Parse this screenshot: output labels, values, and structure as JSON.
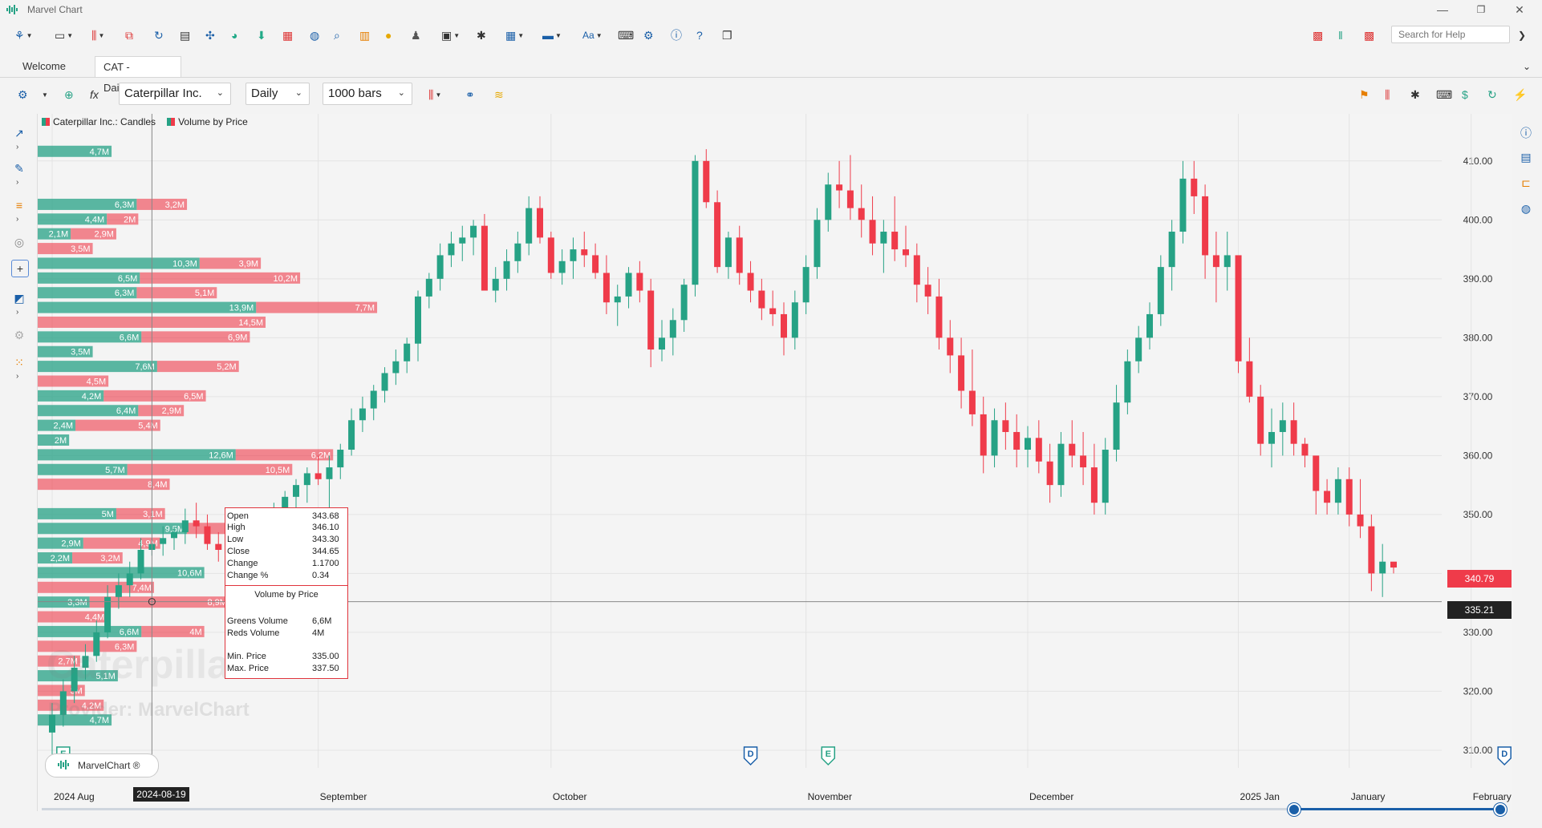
{
  "app": {
    "title": "Marvel Chart"
  },
  "window": {
    "minimize": "—",
    "restore": "❐",
    "close": "✕"
  },
  "help": {
    "placeholder": "Search for Help"
  },
  "tabs": [
    {
      "label": "Welcome"
    },
    {
      "label": "CAT - Daily",
      "close": "✕"
    }
  ],
  "toolbar2": {
    "symbol": "Caterpillar Inc.",
    "interval": "Daily",
    "bars": "1000 bars"
  },
  "legend": {
    "candles": "Caterpillar Inc.: Candles",
    "volume": "Volume by Price"
  },
  "colors": {
    "up": "#26a285",
    "down": "#ef3b4a",
    "accent": "#1a5fa8"
  },
  "tooltip": {
    "rows": [
      {
        "label": "Open",
        "value": "343.68"
      },
      {
        "label": "High",
        "value": "346.10"
      },
      {
        "label": "Low",
        "value": "343.30"
      },
      {
        "label": "Close",
        "value": "344.65"
      },
      {
        "label": "Change",
        "value": "1.1700"
      },
      {
        "label": "Change %",
        "value": "0.34"
      }
    ],
    "vbp_title": "Volume by Price",
    "vbp_rows": [
      {
        "label": "Greens Volume",
        "value": "6,6M"
      },
      {
        "label": "Reds Volume",
        "value": "4M"
      },
      {
        "label": "Min. Price",
        "value": "335.00"
      },
      {
        "label": "Max. Price",
        "value": "337.50"
      }
    ]
  },
  "watermark": {
    "name": "Caterpillar Inc.",
    "provider": "Provider: MarvelChart"
  },
  "brand": "MarvelChart ®",
  "price_tags": {
    "last": "340.79",
    "cursor": "335.21"
  },
  "date_tag": "2024-08-19",
  "chart_data": {
    "type": "candlestick",
    "y_ticks": [
      "410.00",
      "400.00",
      "390.00",
      "380.00",
      "370.00",
      "360.00",
      "350.00",
      "340.00",
      "330.00",
      "320.00",
      "310.00"
    ],
    "y_tick_values": [
      410,
      400,
      390,
      380,
      370,
      360,
      350,
      340,
      330,
      320,
      310
    ],
    "x_labels": [
      {
        "label": "2024 Aug",
        "day": 0
      },
      {
        "label": "September",
        "day": 24
      },
      {
        "label": "October",
        "day": 45
      },
      {
        "label": "November",
        "day": 68
      },
      {
        "label": "December",
        "day": 88
      },
      {
        "label": "2025 Jan",
        "day": 107
      },
      {
        "label": "January",
        "day": 117
      },
      {
        "label": "February",
        "day": 128
      }
    ],
    "events": [
      {
        "type": "E",
        "day": 1
      },
      {
        "type": "D",
        "day": 63
      },
      {
        "type": "E",
        "day": 70
      },
      {
        "type": "D",
        "day": 131
      },
      {
        "type": "E",
        "day": 137
      }
    ],
    "candles": [
      [
        313,
        318,
        306,
        316
      ],
      [
        316,
        322,
        314,
        320
      ],
      [
        320,
        326,
        318,
        324
      ],
      [
        324,
        328,
        322,
        326
      ],
      [
        326,
        332,
        325,
        330
      ],
      [
        330,
        338,
        329,
        336
      ],
      [
        336,
        340,
        334,
        338
      ],
      [
        338,
        342,
        336,
        340
      ],
      [
        340,
        346,
        339,
        344
      ],
      [
        344,
        346,
        343,
        345
      ],
      [
        345,
        348,
        343,
        346
      ],
      [
        346,
        348,
        344,
        347
      ],
      [
        347,
        351,
        345,
        349
      ],
      [
        349,
        352,
        346,
        348
      ],
      [
        348,
        350,
        344,
        345
      ],
      [
        345,
        347,
        342,
        344
      ],
      [
        344,
        346,
        340,
        341
      ],
      [
        341,
        345,
        339,
        343
      ],
      [
        343,
        346,
        341,
        345
      ],
      [
        345,
        349,
        344,
        348
      ],
      [
        348,
        352,
        346,
        351
      ],
      [
        351,
        354,
        349,
        353
      ],
      [
        353,
        356,
        350,
        355
      ],
      [
        355,
        358,
        352,
        357
      ],
      [
        357,
        360,
        355,
        356
      ],
      [
        356,
        360,
        350,
        358
      ],
      [
        358,
        362,
        356,
        361
      ],
      [
        361,
        368,
        360,
        366
      ],
      [
        366,
        370,
        364,
        368
      ],
      [
        368,
        372,
        366,
        371
      ],
      [
        371,
        375,
        369,
        374
      ],
      [
        374,
        378,
        372,
        376
      ],
      [
        376,
        380,
        374,
        379
      ],
      [
        379,
        388,
        376,
        387
      ],
      [
        387,
        391,
        385,
        390
      ],
      [
        390,
        396,
        388,
        394
      ],
      [
        394,
        398,
        392,
        396
      ],
      [
        396,
        399,
        393,
        397
      ],
      [
        397,
        400,
        394,
        399
      ],
      [
        399,
        401,
        389,
        388
      ],
      [
        388,
        392,
        386,
        390
      ],
      [
        390,
        395,
        388,
        393
      ],
      [
        393,
        398,
        391,
        396
      ],
      [
        396,
        404,
        394,
        402
      ],
      [
        402,
        404,
        396,
        397
      ],
      [
        397,
        398,
        390,
        391
      ],
      [
        391,
        395,
        389,
        393
      ],
      [
        393,
        397,
        390,
        395
      ],
      [
        395,
        398,
        392,
        394
      ],
      [
        394,
        396,
        390,
        391
      ],
      [
        391,
        394,
        384,
        386
      ],
      [
        386,
        389,
        382,
        387
      ],
      [
        387,
        392,
        385,
        391
      ],
      [
        391,
        393,
        386,
        388
      ],
      [
        388,
        390,
        375,
        378
      ],
      [
        378,
        383,
        376,
        380
      ],
      [
        380,
        385,
        377,
        383
      ],
      [
        383,
        390,
        381,
        389
      ],
      [
        389,
        411,
        387,
        410
      ],
      [
        410,
        412,
        402,
        403
      ],
      [
        403,
        405,
        391,
        392
      ],
      [
        392,
        398,
        390,
        397
      ],
      [
        397,
        399,
        389,
        391
      ],
      [
        391,
        393,
        386,
        388
      ],
      [
        388,
        390,
        383,
        385
      ],
      [
        385,
        388,
        382,
        384
      ],
      [
        384,
        386,
        377,
        380
      ],
      [
        380,
        388,
        378,
        386
      ],
      [
        386,
        394,
        384,
        392
      ],
      [
        392,
        402,
        390,
        400
      ],
      [
        400,
        408,
        398,
        406
      ],
      [
        406,
        410,
        402,
        405
      ],
      [
        405,
        411,
        400,
        402
      ],
      [
        402,
        406,
        397,
        400
      ],
      [
        400,
        404,
        394,
        396
      ],
      [
        396,
        400,
        391,
        398
      ],
      [
        398,
        404,
        393,
        395
      ],
      [
        395,
        399,
        392,
        394
      ],
      [
        394,
        396,
        386,
        389
      ],
      [
        389,
        392,
        384,
        387
      ],
      [
        387,
        390,
        378,
        380
      ],
      [
        380,
        383,
        374,
        377
      ],
      [
        377,
        380,
        368,
        371
      ],
      [
        371,
        378,
        365,
        367
      ],
      [
        367,
        370,
        357,
        360
      ],
      [
        360,
        368,
        358,
        366
      ],
      [
        366,
        369,
        361,
        364
      ],
      [
        364,
        367,
        358,
        361
      ],
      [
        361,
        365,
        358,
        363
      ],
      [
        363,
        366,
        357,
        359
      ],
      [
        359,
        362,
        352,
        355
      ],
      [
        355,
        364,
        353,
        362
      ],
      [
        362,
        366,
        358,
        360
      ],
      [
        360,
        364,
        355,
        358
      ],
      [
        358,
        362,
        350,
        352
      ],
      [
        352,
        363,
        350,
        361
      ],
      [
        361,
        372,
        359,
        369
      ],
      [
        369,
        378,
        367,
        376
      ],
      [
        376,
        382,
        374,
        380
      ],
      [
        380,
        386,
        378,
        384
      ],
      [
        384,
        394,
        382,
        392
      ],
      [
        392,
        400,
        388,
        398
      ],
      [
        398,
        410,
        396,
        407
      ],
      [
        407,
        410,
        401,
        404
      ],
      [
        404,
        406,
        390,
        394
      ],
      [
        394,
        398,
        386,
        392
      ],
      [
        392,
        398,
        388,
        394
      ],
      [
        394,
        382,
        374,
        376
      ],
      [
        376,
        380,
        369,
        370
      ],
      [
        370,
        372,
        360,
        362
      ],
      [
        362,
        368,
        358,
        364
      ],
      [
        364,
        369,
        360,
        366
      ],
      [
        366,
        369,
        360,
        362
      ],
      [
        362,
        363,
        358,
        360
      ],
      [
        360,
        358,
        350,
        354
      ],
      [
        354,
        356,
        350,
        352
      ],
      [
        352,
        358,
        350,
        356
      ],
      [
        356,
        358,
        348,
        350
      ],
      [
        350,
        356,
        346,
        348
      ],
      [
        348,
        350,
        337,
        340
      ],
      [
        340,
        345,
        336,
        342
      ],
      [
        342,
        341,
        340,
        341
      ]
    ],
    "vbp": [
      {
        "price": 411.5,
        "green": 4.7,
        "red": 0
      },
      {
        "price": 402.5,
        "green": 6.3,
        "red": 3.2
      },
      {
        "price": 400,
        "green": 4.4,
        "red": 2
      },
      {
        "price": 397.5,
        "green": 2.1,
        "red": 2.9
      },
      {
        "price": 395,
        "green": 0,
        "red": 3.5
      },
      {
        "price": 392.5,
        "green": 10.3,
        "red": 3.9
      },
      {
        "price": 390,
        "green": 6.5,
        "red": 10.2
      },
      {
        "price": 387.5,
        "green": 6.3,
        "red": 5.1
      },
      {
        "price": 385,
        "green": 13.9,
        "red": 7.7
      },
      {
        "price": 382.5,
        "green": 0,
        "red": 14.5
      },
      {
        "price": 380,
        "green": 6.6,
        "red": 6.9
      },
      {
        "price": 377.5,
        "green": 3.5,
        "red": 0
      },
      {
        "price": 375,
        "green": 7.6,
        "red": 5.2
      },
      {
        "price": 372.5,
        "green": 0,
        "red": 4.5
      },
      {
        "price": 370,
        "green": 4.2,
        "red": 6.5
      },
      {
        "price": 367.5,
        "green": 6.4,
        "red": 2.9
      },
      {
        "price": 365,
        "green": 2.4,
        "red": 5.4
      },
      {
        "price": 362.5,
        "green": 2,
        "red": 0
      },
      {
        "price": 360,
        "green": 12.6,
        "red": 6.2
      },
      {
        "price": 357.5,
        "green": 5.7,
        "red": 10.5
      },
      {
        "price": 355,
        "green": 0,
        "red": 8.4
      },
      {
        "price": 350,
        "green": 5,
        "red": 3.1
      },
      {
        "price": 347.5,
        "green": 9.5,
        "red": 4.9
      },
      {
        "price": 345,
        "green": 2.9,
        "red": 4.9
      },
      {
        "price": 342.5,
        "green": 2.2,
        "red": 3.2
      },
      {
        "price": 340,
        "green": 10.6,
        "red": 0
      },
      {
        "price": 337.5,
        "green": 0,
        "red": 7.4
      },
      {
        "price": 335,
        "green": 3.3,
        "red": 8.9
      },
      {
        "price": 332.5,
        "green": 0,
        "red": 4.4
      },
      {
        "price": 330,
        "green": 6.6,
        "red": 4
      },
      {
        "price": 327.5,
        "green": 0,
        "red": 6.3
      },
      {
        "price": 325,
        "green": 0,
        "red": 2.7
      },
      {
        "price": 322.5,
        "green": 5.1,
        "red": 0
      },
      {
        "price": 320,
        "green": 0,
        "red": 3
      },
      {
        "price": 317.5,
        "green": 0,
        "red": 4.2
      },
      {
        "price": 315,
        "green": 4.7,
        "red": 0
      }
    ],
    "vbp_labels": [
      {
        "price": 411.5,
        "text": "4,7M"
      },
      {
        "price": 402.5,
        "text": "6,3M"
      },
      {
        "price": 402.5,
        "text": "3,2M"
      },
      {
        "price": 400,
        "text": "4,4M"
      },
      {
        "price": 400,
        "text": "2M"
      },
      {
        "price": 397.5,
        "text": "2,1M"
      },
      {
        "price": 397.5,
        "text": "2,9M"
      },
      {
        "price": 395,
        "text": "3,5M"
      },
      {
        "price": 392.5,
        "text": "10,3M"
      },
      {
        "price": 392.5,
        "text": "3,9M"
      },
      {
        "price": 390,
        "text": "6,5M"
      },
      {
        "price": 390,
        "text": "10,2M"
      },
      {
        "price": 387.5,
        "text": "6,3M"
      },
      {
        "price": 387.5,
        "text": "5,1M"
      },
      {
        "price": 385,
        "text": "13,9M"
      },
      {
        "price": 385,
        "text": "7,7M"
      },
      {
        "price": 382.5,
        "text": "14,5M"
      },
      {
        "price": 380,
        "text": "6,6M"
      },
      {
        "price": 380,
        "text": "6,9M"
      },
      {
        "price": 377.5,
        "text": "3,5M"
      },
      {
        "price": 375,
        "text": "7,6M"
      },
      {
        "price": 375,
        "text": "5,2M"
      },
      {
        "price": 372.5,
        "text": "4,5M"
      },
      {
        "price": 370,
        "text": "4,2M"
      },
      {
        "price": 370,
        "text": "6,5M"
      },
      {
        "price": 367.5,
        "text": "6,4M"
      },
      {
        "price": 367.5,
        "text": "2,9M"
      },
      {
        "price": 365,
        "text": "2,4M"
      },
      {
        "price": 365,
        "text": "5,4M"
      },
      {
        "price": 362.5,
        "text": "2M"
      },
      {
        "price": 360,
        "text": "12,6M"
      },
      {
        "price": 360,
        "text": "6,2M"
      },
      {
        "price": 357.5,
        "text": "5,7M"
      },
      {
        "price": 357.5,
        "text": "10,5M"
      },
      {
        "price": 355,
        "text": "8,4M"
      },
      {
        "price": 350,
        "text": "5M"
      },
      {
        "price": 350,
        "text": "3,1M"
      },
      {
        "price": 347.5,
        "text": "9,5M"
      },
      {
        "price": 347.5,
        "text": "4,9M"
      },
      {
        "price": 345,
        "text": "2,9M"
      },
      {
        "price": 345,
        "text": "4,9M"
      },
      {
        "price": 342.5,
        "text": "2,2M"
      },
      {
        "price": 342.5,
        "text": "3,2M"
      },
      {
        "price": 340,
        "text": "10,6M"
      },
      {
        "price": 337.5,
        "text": "7,4M"
      },
      {
        "price": 335,
        "text": "3,3M"
      },
      {
        "price": 335,
        "text": "8,9M"
      },
      {
        "price": 332.5,
        "text": "4,4M"
      },
      {
        "price": 330,
        "text": "6,6M"
      },
      {
        "price": 330,
        "text": "4M"
      },
      {
        "price": 327.5,
        "text": "6,3M"
      },
      {
        "price": 325,
        "text": "2,7M"
      },
      {
        "price": 322.5,
        "text": "5,1M"
      },
      {
        "price": 320,
        "text": "3M"
      },
      {
        "price": 317.5,
        "text": "4,2M"
      },
      {
        "price": 315,
        "text": "4,7M"
      }
    ],
    "ylim": [
      307,
      418
    ],
    "last_price": 340.79,
    "cursor_price": 335.21
  }
}
